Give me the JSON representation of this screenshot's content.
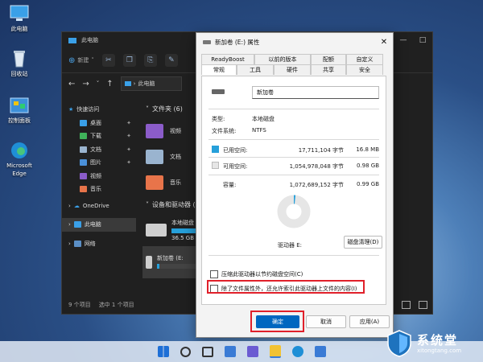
{
  "desktop": {
    "icons": [
      {
        "label": "此电脑"
      },
      {
        "label": "回收站"
      },
      {
        "label": "控制面板"
      },
      {
        "label": "Microsoft Edge"
      }
    ]
  },
  "explorer": {
    "title": "此电脑",
    "new_label": "新建",
    "address": "此电脑",
    "sidebar": [
      {
        "label": "快速访问"
      },
      {
        "label": "桌面"
      },
      {
        "label": "下载"
      },
      {
        "label": "文档"
      },
      {
        "label": "图片"
      },
      {
        "label": "视频"
      },
      {
        "label": "音乐"
      },
      {
        "label": "OneDrive"
      },
      {
        "label": "此电脑"
      },
      {
        "label": "网络"
      }
    ],
    "folders_header": "文件夹 (6)",
    "folders": [
      {
        "label": "视频"
      },
      {
        "label": "文档"
      },
      {
        "label": "音乐"
      }
    ],
    "devices_header": "设备和驱动器 (2",
    "drives": [
      {
        "label": "本地磁盘",
        "free": "36.5 GB",
        "used_fraction": 0.6
      },
      {
        "label": "新加卷 (E:",
        "free": "",
        "used_fraction": 0.05
      }
    ],
    "status_items": "9 个项目",
    "status_selected": "选中 1 个项目"
  },
  "dialog": {
    "title": "新加卷 (E:) 属性",
    "tabs_row1": [
      "ReadyBoost",
      "以前的版本",
      "配额",
      "自定义"
    ],
    "tabs_row2": [
      "常规",
      "工具",
      "硬件",
      "共享",
      "安全"
    ],
    "volume_name": "新加卷",
    "type_label": "类型:",
    "type_value": "本地磁盘",
    "fs_label": "文件系统:",
    "fs_value": "NTFS",
    "used_label": "已用空间:",
    "used_bytes": "17,711,104 字节",
    "used_size": "16.8 MB",
    "free_label": "可用空间:",
    "free_bytes": "1,054,978,048 字节",
    "free_size": "0.98 GB",
    "capacity_label": "容量:",
    "capacity_bytes": "1,072,689,152 字节",
    "capacity_size": "0.99 GB",
    "drive_label": "驱动器 E:",
    "cleanup_button": "磁盘清理(D)",
    "compress_option": "压缩此驱动器以节约磁盘空间(C)",
    "index_option": "除了文件属性外，还允许索引此驱动器上文件的内容(I)",
    "used_fraction": 0.0165,
    "colors": {
      "used": "#26a0da",
      "free": "#e6e6e6",
      "highlight": "#e0202a"
    },
    "buttons": {
      "ok": "确定",
      "cancel": "取消",
      "apply": "应用(A)"
    }
  },
  "watermark": {
    "title": "系统堂",
    "url": "xitongtang.com"
  }
}
